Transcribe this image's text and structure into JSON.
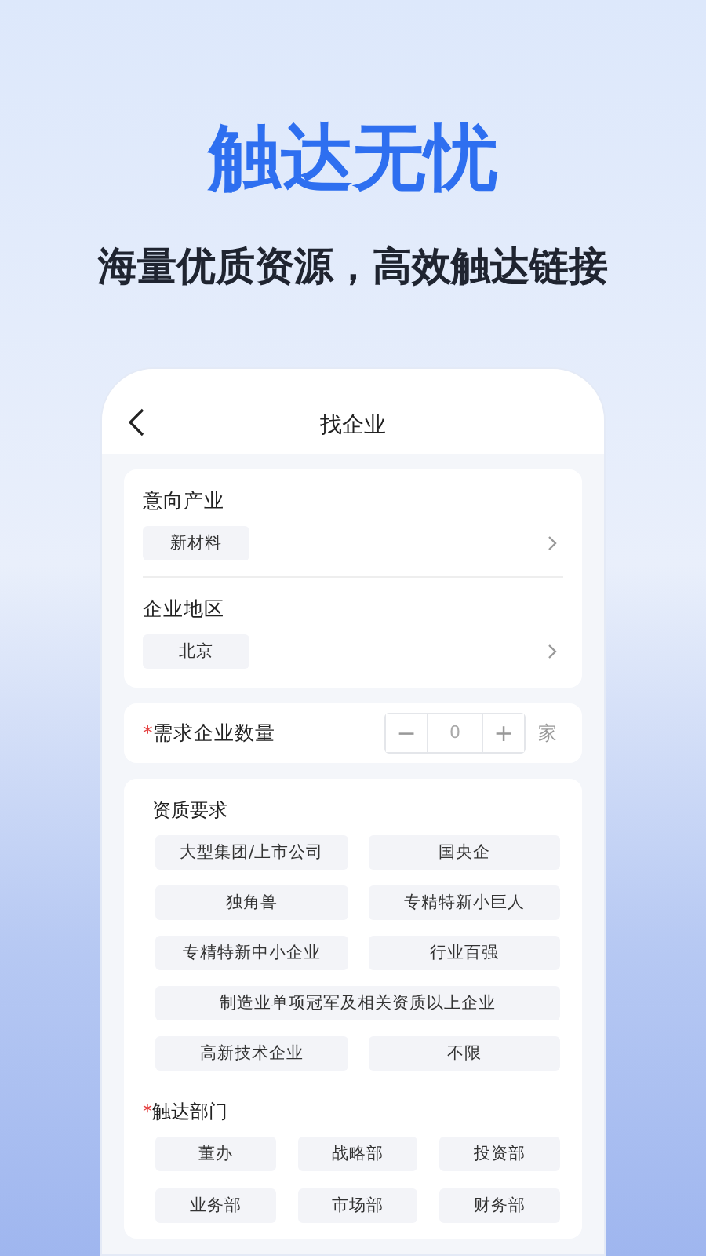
{
  "headline": "触达无忧",
  "subtitle": "海量优质资源，高效触达链接",
  "screen": {
    "title": "找企业",
    "selectors": [
      {
        "label": "意向产业",
        "value": "新材料"
      },
      {
        "label": "企业地区",
        "value": "北京"
      }
    ],
    "quantity": {
      "required_mark": "*",
      "label": "需求企业数量",
      "minus": "−",
      "value": "0",
      "plus": "+",
      "unit": "家"
    },
    "qualification": {
      "title": "资质要求",
      "options": [
        {
          "label": "大型集团/上市公司",
          "wide": false
        },
        {
          "label": "国央企",
          "wide": false
        },
        {
          "label": "独角兽",
          "wide": false
        },
        {
          "label": "专精特新小巨人",
          "wide": false
        },
        {
          "label": "专精特新中小企业",
          "wide": false
        },
        {
          "label": "行业百强",
          "wide": false
        },
        {
          "label": "制造业单项冠军及相关资质以上企业",
          "wide": true
        },
        {
          "label": "高新技术企业",
          "wide": false
        },
        {
          "label": "不限",
          "wide": false
        }
      ]
    },
    "departments": {
      "required_mark": "*",
      "title": "触达部门",
      "options": [
        "董办",
        "战略部",
        "投资部",
        "业务部",
        "市场部",
        "财务部"
      ]
    }
  }
}
